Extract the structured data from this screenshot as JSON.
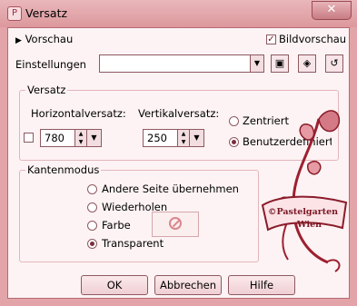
{
  "window": {
    "title": "Versatz",
    "close_label": "✕"
  },
  "preview": {
    "toggle_label": "Vorschau",
    "image_preview_label": "Bildvorschau",
    "image_preview_checked": true
  },
  "settings": {
    "label": "Einstellungen",
    "value": ""
  },
  "offset_group": {
    "title": "Versatz",
    "horizontal_label": "Horizontalversatz:",
    "horizontal_value": "780",
    "vertical_label": "Vertikalversatz:",
    "vertical_value": "250",
    "centered_label": "Zentriert",
    "custom_label": "Benutzerdefiniert",
    "selected": "custom"
  },
  "edge_group": {
    "title": "Kantenmodus",
    "options": [
      "Andere Seite übernehmen",
      "Wiederholen",
      "Farbe",
      "Transparent"
    ],
    "selected": "Transparent"
  },
  "watermark": {
    "line1": "©Pastelgarten",
    "line2": "Wien"
  },
  "buttons": {
    "ok": "OK",
    "cancel": "Abbrechen",
    "help": "Hilfe"
  }
}
